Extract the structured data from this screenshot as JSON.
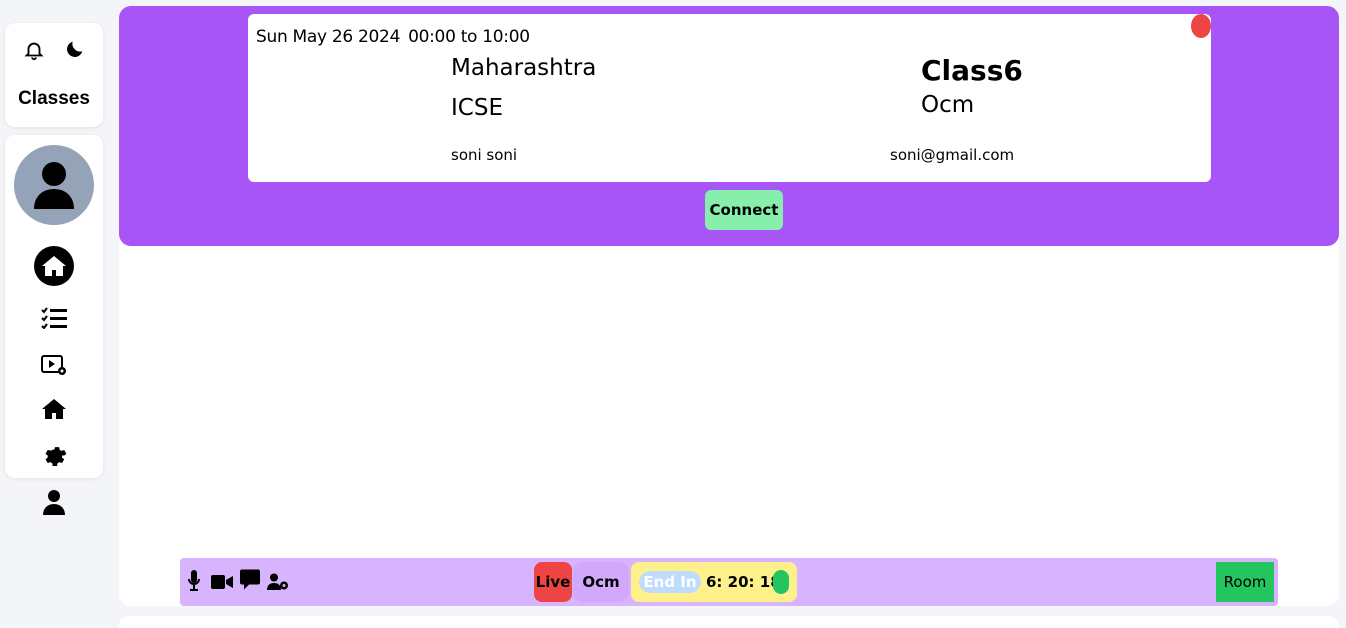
{
  "sidebar": {
    "brand": "Classes",
    "icons": [
      "bell-icon",
      "moon-icon",
      "user-avatar-icon",
      "home-icon",
      "task-list-icon",
      "video-settings-icon",
      "home-icon",
      "gear-icon",
      "user-icon"
    ]
  },
  "card": {
    "date": "Sun May 26 2024",
    "time_range": "00:00 to 10:00",
    "state": "Maharashtra",
    "board": "ICSE",
    "teacher": "soni soni",
    "class_name": "Class6",
    "subject": "Ocm",
    "email": "soni@gmail.com"
  },
  "connect_label": "Connect",
  "toolbar": {
    "live_label": "Live",
    "subject": "Ocm",
    "end_in_label": "End In",
    "time_left": "6: 20: 18",
    "room_label": "Room"
  },
  "colors": {
    "banner": "#a855f7",
    "toolbar": "#d8b4fe",
    "live": "#ef4444",
    "connect": "#86efac",
    "room": "#22c55e",
    "timer": "#fef08a"
  }
}
